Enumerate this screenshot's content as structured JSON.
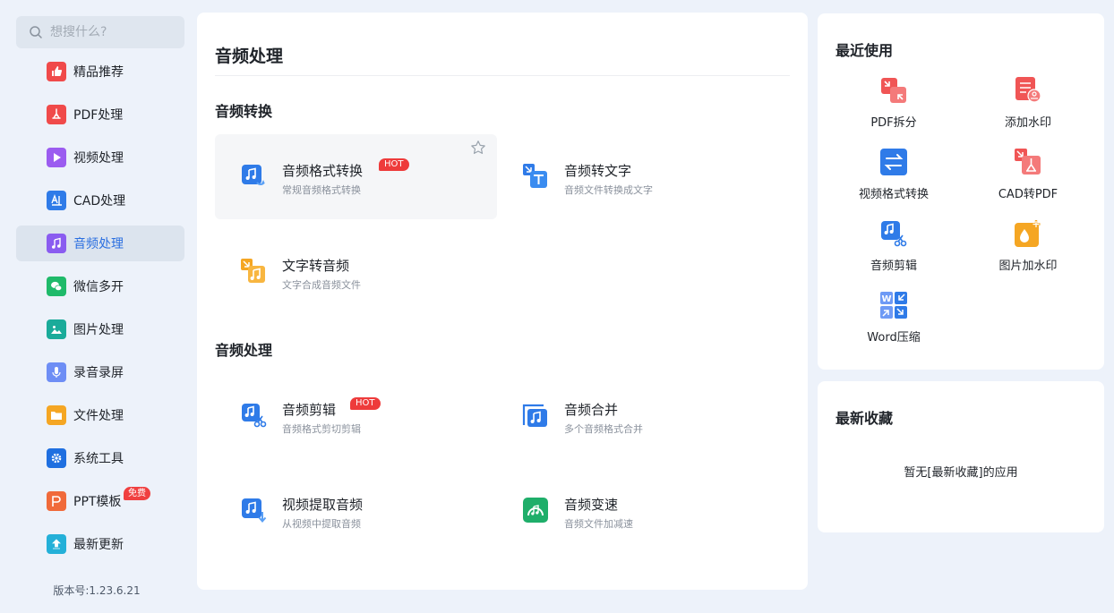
{
  "search": {
    "placeholder": "想搜什么?"
  },
  "sidebar": {
    "items": [
      {
        "label": "精品推荐",
        "color": "#f04a4a"
      },
      {
        "label": "PDF处理",
        "color": "#f04a4a"
      },
      {
        "label": "视频处理",
        "color": "#9b5cf0"
      },
      {
        "label": "CAD处理",
        "color": "#2f7be8"
      },
      {
        "label": "音频处理",
        "color": "#8a5cf0",
        "active": true
      },
      {
        "label": "微信多开",
        "color": "#1fba6a"
      },
      {
        "label": "图片处理",
        "color": "#1aab9a"
      },
      {
        "label": "录音录屏",
        "color": "#6e8ef5"
      },
      {
        "label": "文件处理",
        "color": "#f5a623"
      },
      {
        "label": "系统工具",
        "color": "#1f6fe0"
      },
      {
        "label": "PPT模板",
        "color": "#f06a3a",
        "badge": "免费"
      },
      {
        "label": "最新更新",
        "color": "#24b0d8"
      }
    ],
    "version": "版本号:1.23.6.21"
  },
  "main": {
    "title": "音频处理",
    "sections": [
      {
        "title": "音频转换",
        "cards": [
          {
            "title": "音频格式转换",
            "desc": "常规音频格式转换",
            "hot": "HOT"
          },
          {
            "title": "音频转文字",
            "desc": "音频文件转换成文字"
          },
          {
            "title": "文字转音频",
            "desc": "文字合成音频文件"
          }
        ]
      },
      {
        "title": "音频处理",
        "cards": [
          {
            "title": "音频剪辑",
            "desc": "音频格式剪切剪辑",
            "hot": "HOT"
          },
          {
            "title": "音频合并",
            "desc": "多个音频格式合并"
          },
          {
            "title": "视频提取音频",
            "desc": "从视频中提取音频"
          },
          {
            "title": "音频变速",
            "desc": "音频文件加减速"
          }
        ]
      }
    ]
  },
  "recent": {
    "title": "最近使用",
    "items": [
      {
        "label": "PDF拆分"
      },
      {
        "label": "添加水印"
      },
      {
        "label": "视频格式转换"
      },
      {
        "label": "CAD转PDF"
      },
      {
        "label": "音频剪辑"
      },
      {
        "label": "图片加水印"
      },
      {
        "label": "Word压缩"
      }
    ]
  },
  "favorites": {
    "title": "最新收藏",
    "empty_text": "暂无[最新收藏]的应用"
  }
}
